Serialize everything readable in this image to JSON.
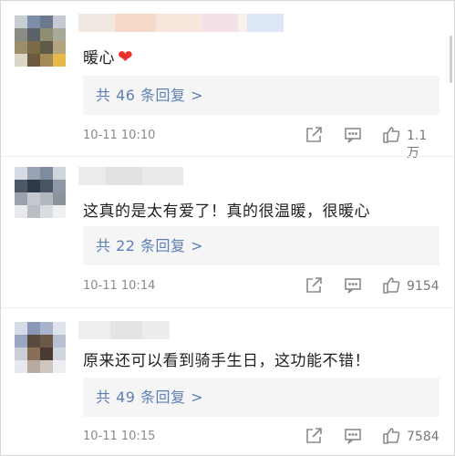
{
  "comments": [
    {
      "text": "暖心",
      "heart": "❤",
      "replies": "共 46 条回复 >",
      "time": "10-11  10:10",
      "likes": "1.1万"
    },
    {
      "text": "这真的是太有爱了！真的很温暖，很暖心",
      "replies": "共 22 条回复 >",
      "time": "10-11  10:14",
      "likes": "9154"
    },
    {
      "text": "原来还可以看到骑手生日，这功能不错！",
      "replies": "共 49 条回复 >",
      "time": "10-11  10:15",
      "likes": "7584"
    }
  ],
  "colors": {
    "link": "#5d7fb5",
    "heart": "#e8332b",
    "meta": "#8a8a8a",
    "reply_bg": "#f5f5f5"
  },
  "icons": [
    "avatar-pixelated",
    "share-icon",
    "comment-icon",
    "like-icon"
  ]
}
